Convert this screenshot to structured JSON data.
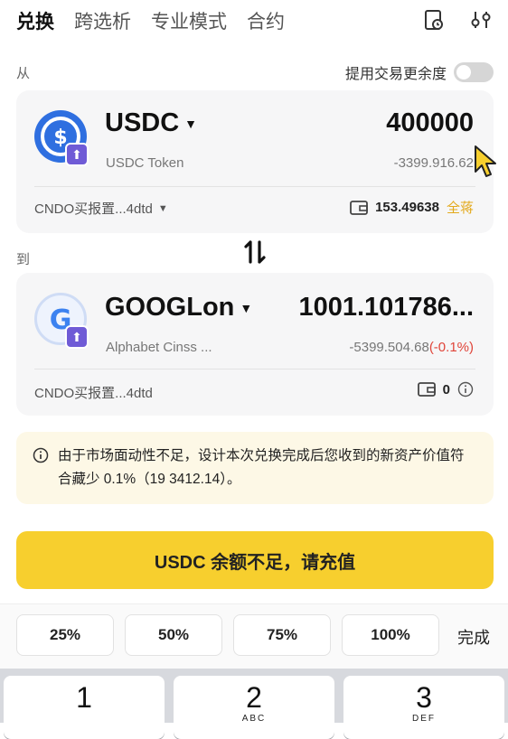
{
  "tabs": [
    "兑换",
    "跨选析",
    "专业模式",
    "合约"
  ],
  "from_label": "从",
  "to_label": "到",
  "toggle_label": "提用交易更余度",
  "from": {
    "symbol": "USDC",
    "token_name": "USDC Token",
    "amount": "400000",
    "usd_value": "-3399.916.62",
    "route": "CNDO买报置...4dtd",
    "balance": "153.49638",
    "max_label": "全蒋",
    "brand_color": "#2f6fe0"
  },
  "to": {
    "symbol": "GOOGLon",
    "token_name": "Alphabet Cinss ...",
    "amount": "1001.101786...",
    "usd_value": "-5399.504.68",
    "price_impact": "(-0.1%)",
    "route": "CNDO买报置...4dtd",
    "balance": "0",
    "brand_color": "#3c82f0"
  },
  "notice": "由于市场面动性不足，设计本次兑换完成后您收到的新资产价值符合藏少 0.1%（19 3412.14）。",
  "cta_label": "USDC 余额不足，请充值",
  "percents": [
    "25%",
    "50%",
    "75%",
    "100%"
  ],
  "done_label": "完成",
  "keys": [
    {
      "num": "1",
      "letters": ""
    },
    {
      "num": "2",
      "letters": "ABC"
    },
    {
      "num": "3",
      "letters": "DEF"
    }
  ],
  "colors": {
    "accent": "#f7cf2e",
    "notice_bg": "#fdf8e6",
    "negative": "#e0453a",
    "max": "#e3a91b"
  }
}
